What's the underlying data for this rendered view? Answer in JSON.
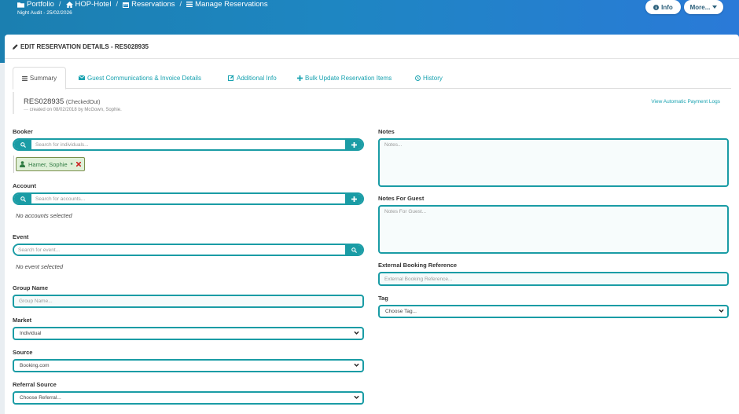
{
  "breadcrumb": {
    "portfolio": "Portfolio",
    "hotel": "HOP-Hotel",
    "reservations": "Reservations",
    "manage": "Manage Reservations",
    "separator": "/"
  },
  "night_audit": "Night Audit - 25/02/2026",
  "top_buttons": {
    "info": "Info",
    "more": "More..."
  },
  "card": {
    "title": "EDIT RESERVATION DETAILS - RES028935"
  },
  "tabs": [
    {
      "label": "Summary",
      "icon": "list-icon"
    },
    {
      "label": "Guest Communications & Invoice Details",
      "icon": "envelope-icon"
    },
    {
      "label": "Additional Info",
      "icon": "edit-icon"
    },
    {
      "label": "Bulk Update Reservation Items",
      "icon": "plus-icon"
    },
    {
      "label": "History",
      "icon": "clock-icon"
    }
  ],
  "reservation": {
    "id": "RES028935",
    "status": "(CheckedOut)",
    "created": "created on 08/02/2018 by McGown, Sophie."
  },
  "payment_link": "View Automatic Payment Logs",
  "booker": {
    "label": "Booker",
    "placeholder": "Search for individuals...",
    "selected": "Hamer, Sophie",
    "star": "*"
  },
  "account": {
    "label": "Account",
    "placeholder": "Search for accounts...",
    "empty": "No accounts selected"
  },
  "event": {
    "label": "Event",
    "placeholder": "Search for event...",
    "empty": "No event selected"
  },
  "group_name": {
    "label": "Group Name",
    "placeholder": "Group Name..."
  },
  "market": {
    "label": "Market",
    "value": "Individual"
  },
  "source": {
    "label": "Source",
    "value": "Booking.com"
  },
  "referral_source": {
    "label": "Referral Source",
    "value": "Choose Referral..."
  },
  "notes": {
    "label": "Notes",
    "placeholder": "Notes..."
  },
  "notes_for_guest": {
    "label": "Notes For Guest",
    "placeholder": "Notes For Guest..."
  },
  "external_ref": {
    "label": "External Booking Reference",
    "placeholder": "External Booking Reference..."
  },
  "tag": {
    "label": "Tag",
    "value": "Choose Tag..."
  },
  "colors": {
    "accent": "#1a9ca5",
    "link": "#19a2b0",
    "header": "#1e86c2",
    "chip_bg": "#dff0d8",
    "remove": "#cc2222"
  }
}
